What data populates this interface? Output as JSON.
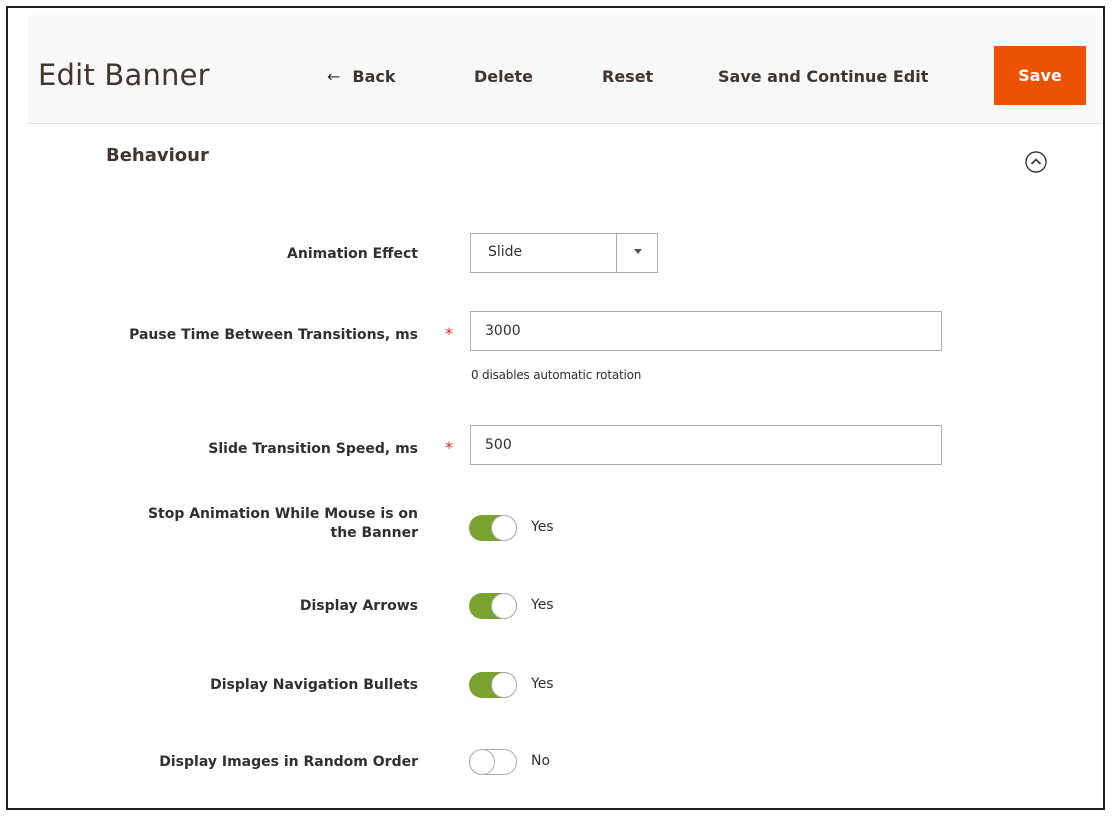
{
  "header": {
    "title": "Edit Banner",
    "back_label": "Back",
    "back_arrow": "←",
    "delete_label": "Delete",
    "reset_label": "Reset",
    "save_continue_label": "Save and Continue Edit",
    "save_label": "Save"
  },
  "section": {
    "title": "Behaviour",
    "collapse_icon": "chevron-up-circle-icon"
  },
  "form": {
    "required_mark": "*",
    "animation_effect": {
      "label": "Animation Effect",
      "value": "Slide"
    },
    "pause_time": {
      "label": "Pause Time Between Transitions, ms",
      "value": "3000",
      "note": "0 disables automatic rotation"
    },
    "transition_speed": {
      "label": "Slide Transition Speed, ms",
      "value": "500"
    },
    "stop_on_hover": {
      "label_line1": "Stop Animation While Mouse is on",
      "label_line2": "the Banner",
      "state": "Yes"
    },
    "display_arrows": {
      "label": "Display Arrows",
      "state": "Yes"
    },
    "display_bullets": {
      "label": "Display Navigation Bullets",
      "state": "Yes"
    },
    "random_order": {
      "label": "Display Images in Random Order",
      "state": "No"
    }
  },
  "colors": {
    "accent": "#eb5202",
    "toggle_on": "#79a22e",
    "required": "#e02b27"
  }
}
